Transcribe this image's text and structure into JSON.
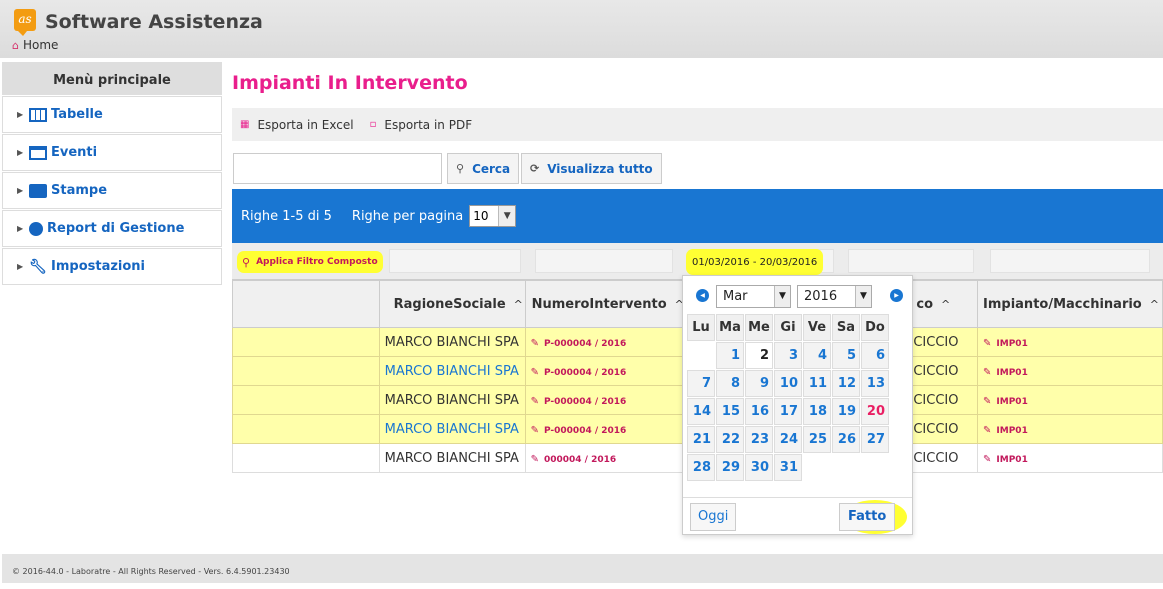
{
  "app": {
    "title": "Software Assistenza",
    "logo_text": "as",
    "breadcrumb_home": "Home"
  },
  "sidebar": {
    "header": "Menù principale",
    "items": [
      {
        "label": "Tabelle",
        "icon": "table-icon"
      },
      {
        "label": "Eventi",
        "icon": "calendar-check-icon"
      },
      {
        "label": "Stampe",
        "icon": "print-icon"
      },
      {
        "label": "Report di Gestione",
        "icon": "pie-chart-icon"
      },
      {
        "label": "Impostazioni",
        "icon": "wrench-icon"
      }
    ]
  },
  "page": {
    "title": "Impianti In Intervento",
    "export_excel": "Esporta in Excel",
    "export_pdf": "Esporta in PDF",
    "search_value": "",
    "search_button": "Cerca",
    "show_all_button": "Visualizza tutto",
    "rows_info": "Righe 1-5 di 5",
    "rows_per_page_label": "Righe per pagina",
    "rows_per_page_value": "10",
    "apply_filter": "Applica Filtro Composto",
    "date_range": "01/03/2016 - 20/03/2016"
  },
  "table": {
    "columns": [
      "RagioneSociale",
      "NumeroIntervento",
      "co",
      "Impianto/Macchinario"
    ],
    "sort_glyph": "^",
    "rows": [
      {
        "ragione": "MARCO BIANCHI SPA",
        "numero": "P-000004 / 2016",
        "tecnico": "CICCIO",
        "impianto": "IMP01",
        "style": "y",
        "link": false
      },
      {
        "ragione": "MARCO BIANCHI SPA",
        "numero": "P-000004 / 2016",
        "tecnico": "CICCIO",
        "impianto": "IMP01",
        "style": "y",
        "link": true
      },
      {
        "ragione": "MARCO BIANCHI SPA",
        "numero": "P-000004 / 2016",
        "tecnico": "CICCIO",
        "impianto": "IMP01",
        "style": "y",
        "link": false
      },
      {
        "ragione": "MARCO BIANCHI SPA",
        "numero": "P-000004 / 2016",
        "tecnico": "CICCIO",
        "impianto": "IMP01",
        "style": "y",
        "link": true
      },
      {
        "ragione": "MARCO BIANCHI SPA",
        "numero": "000004 / 2016",
        "tecnico": "CICCIO",
        "impianto": "IMP01",
        "style": "w",
        "link": false
      }
    ]
  },
  "datepicker": {
    "month": "Mar",
    "year": "2016",
    "weekdays": [
      "Lu",
      "Ma",
      "Me",
      "Gi",
      "Ve",
      "Sa",
      "Do"
    ],
    "weeks": [
      [
        "",
        "1",
        "2",
        "3",
        "4",
        "5",
        "6"
      ],
      [
        "7",
        "8",
        "9",
        "10",
        "11",
        "12",
        "13"
      ],
      [
        "14",
        "15",
        "16",
        "17",
        "18",
        "19",
        "20"
      ],
      [
        "21",
        "22",
        "23",
        "24",
        "25",
        "26",
        "27"
      ],
      [
        "28",
        "29",
        "30",
        "31",
        "",
        "",
        ""
      ]
    ],
    "today_day": "2",
    "selected_day": "20",
    "today_button": "Oggi",
    "done_button": "Fatto"
  },
  "footer": {
    "text": "© 2016-44.0 - Laboratre - All Rights Reserved - Vers. 6.4.5901.23430"
  },
  "colors": {
    "accent_pink": "#e91e8c",
    "primary_blue": "#1976d2",
    "row_highlight": "#ffffaa",
    "annotation_yellow": "#ffff33"
  }
}
